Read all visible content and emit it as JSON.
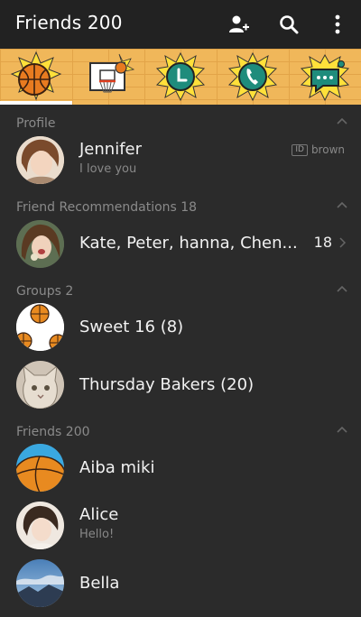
{
  "header": {
    "title": "Friends 200",
    "icons": [
      "add-friend-icon",
      "search-icon",
      "more-vert-icon"
    ]
  },
  "tabs": [
    {
      "name": "basketball-tab",
      "icon": "basketball-icon"
    },
    {
      "name": "hoop-tab",
      "icon": "basketball-hoop-icon"
    },
    {
      "name": "timeline-tab",
      "icon": "clock-icon"
    },
    {
      "name": "calls-tab",
      "icon": "phone-icon"
    },
    {
      "name": "more-tab",
      "icon": "chat-bubble-icon"
    }
  ],
  "colors": {
    "accent_teal": "#1f8c7c",
    "tab_bg": "#f0b75a",
    "background": "#2b2b2b"
  },
  "sections": {
    "profile": {
      "label": "Profile"
    },
    "recommendations": {
      "label": "Friend Recommendations 18"
    },
    "groups": {
      "label": "Groups 2"
    },
    "friends": {
      "label": "Friends 200"
    }
  },
  "profile": {
    "name": "Jennifer",
    "status": "I love you",
    "id_label": "ID",
    "id_value": "brown"
  },
  "recommendations": {
    "names": "Kate, Peter, hanna, Chen...",
    "count": "18"
  },
  "groups": [
    {
      "name": "Sweet 16 (8)"
    },
    {
      "name": "Thursday Bakers (20)"
    }
  ],
  "friends": [
    {
      "name": "Aiba miki",
      "status": ""
    },
    {
      "name": "Alice",
      "status": "Hello!"
    },
    {
      "name": "Bella",
      "status": ""
    }
  ]
}
